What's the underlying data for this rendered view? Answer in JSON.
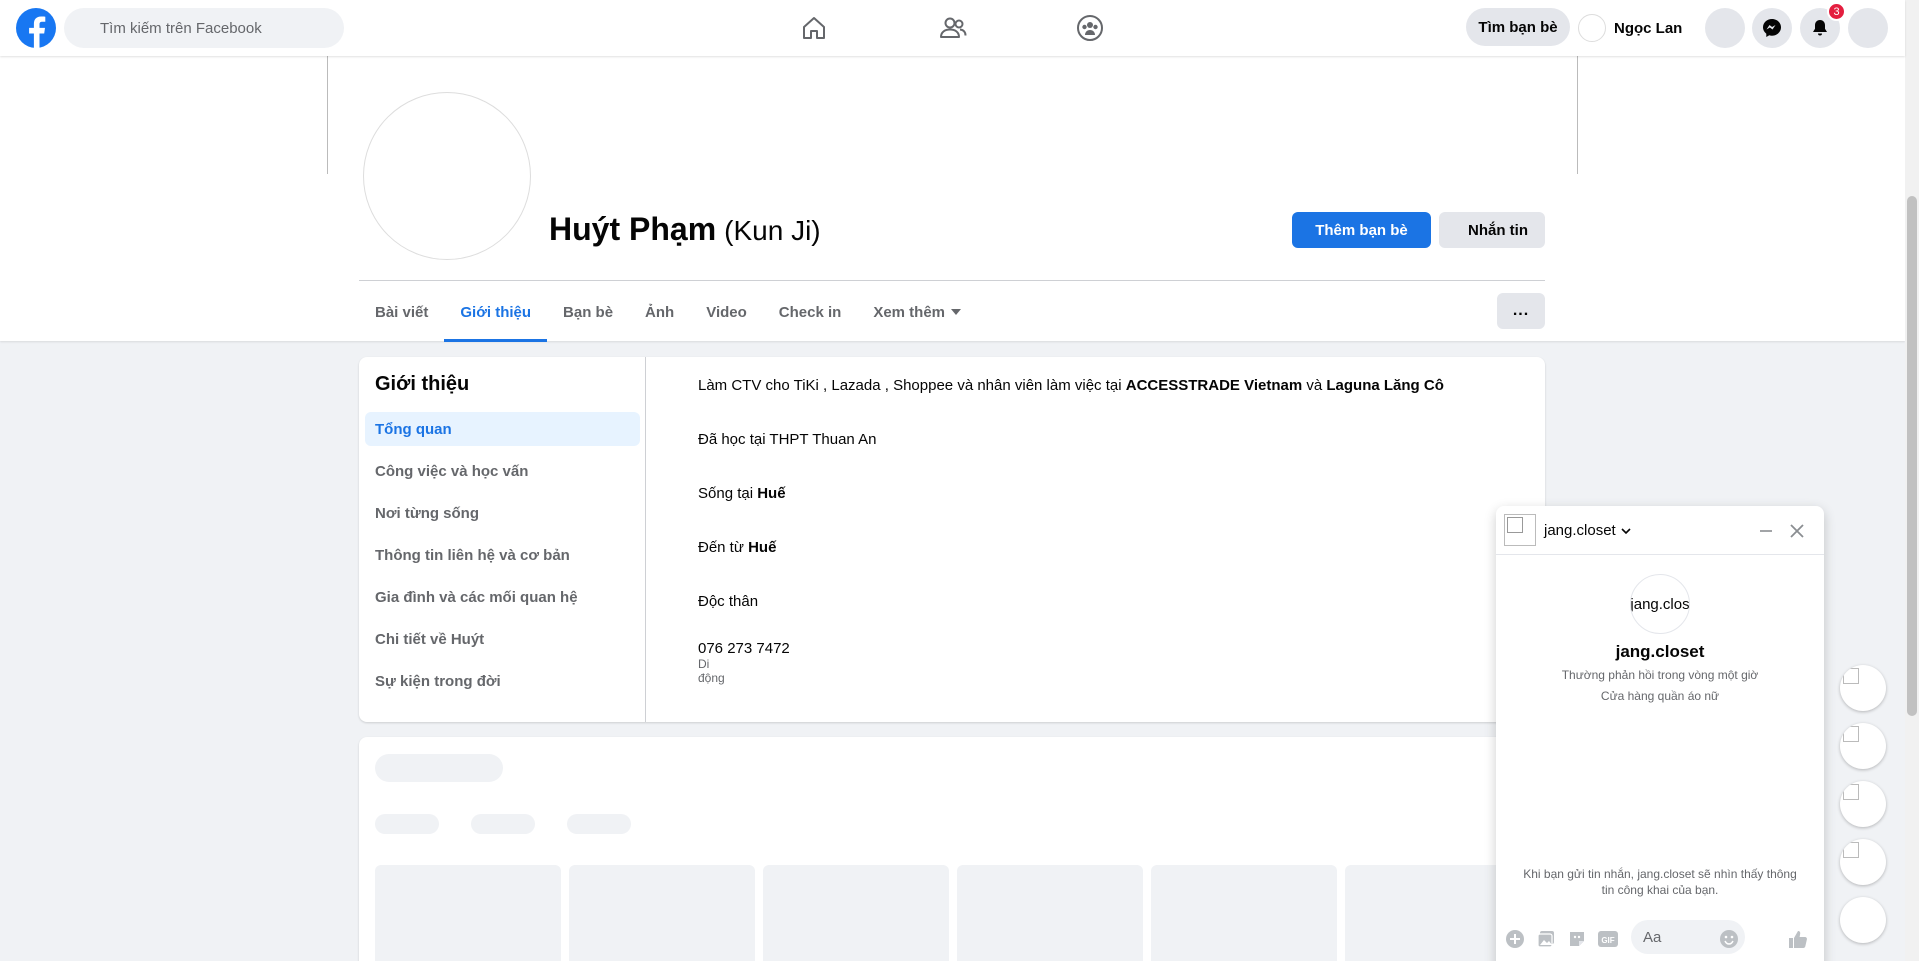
{
  "topbar": {
    "search_placeholder": "Tìm kiếm trên Facebook",
    "find_friends_label": "Tìm bạn bè",
    "user_name": "Ngọc Lan",
    "notification_count": "3",
    "brand_color": "#1877f2"
  },
  "profile": {
    "name": "Huýt Phạm",
    "alternate_name": "(Kun Ji)",
    "add_friend_label": "Thêm bạn bè",
    "message_label": "Nhắn tin",
    "more_label": "..."
  },
  "tabs": [
    {
      "label": "Bài viết"
    },
    {
      "label": "Giới thiệu",
      "active": true
    },
    {
      "label": "Bạn bè"
    },
    {
      "label": "Ảnh"
    },
    {
      "label": "Video"
    },
    {
      "label": "Check in"
    },
    {
      "label": "Xem thêm"
    }
  ],
  "about": {
    "title": "Giới thiệu",
    "menu": [
      "Tổng quan",
      "Công việc và học vấn",
      "Nơi từng sống",
      "Thông tin liên hệ và cơ bản",
      "Gia đình và các mối quan hệ",
      "Chi tiết về Huýt",
      "Sự kiện trong đời"
    ],
    "work": {
      "prefix": "Làm CTV cho TiKi , Lazada , Shoppee và nhân viên làm việc tại",
      "company1": "ACCESSTRADE Vietnam",
      "and": "và",
      "company2": "Laguna Lăng Cô"
    },
    "education": "Đã học tại THPT Thuan An",
    "lives_prefix": "Sống tại",
    "lives_place": "Huế",
    "from_prefix": "Đến từ",
    "from_place": "Huế",
    "relationship": "Độc thân",
    "phone": "076 273 7472",
    "phone_type": "Di động"
  },
  "chat": {
    "header_name": "jang.closet",
    "avatar_alt": "jang.clos",
    "title": "jang.closet",
    "response_time": "Thường phản hồi trong vòng một giờ",
    "category": "Cửa hàng quần áo nữ",
    "notice": "Khi bạn gửi tin nhắn, jang.closet sẽ nhìn thấy thông tin công khai của bạn.",
    "input_placeholder": "Aa"
  }
}
